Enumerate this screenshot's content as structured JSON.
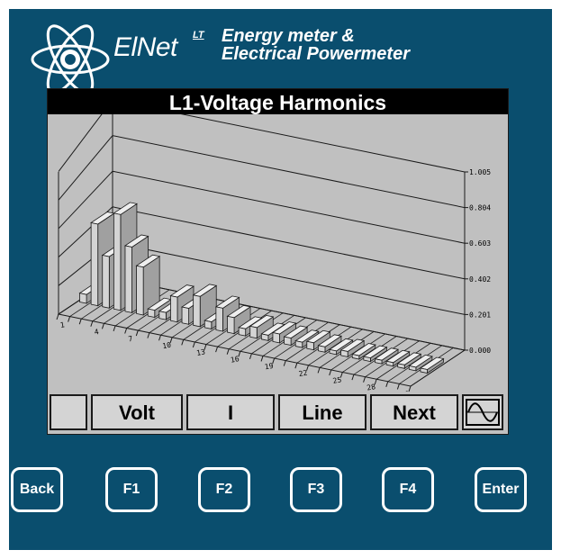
{
  "brand": {
    "name": "ElNet",
    "superscript": "LT",
    "tagline_line1": "Energy meter &",
    "tagline_line2": "Electrical Powermeter"
  },
  "screen": {
    "title": "L1-Voltage Harmonics"
  },
  "chart_data": {
    "type": "bar",
    "title": "L1-Voltage Harmonics",
    "style": "3d-bar",
    "x_tick_labels": [
      "1",
      "4",
      "7",
      "10",
      "13",
      "16",
      "19",
      "22",
      "25",
      "28",
      "31"
    ],
    "y_tick_labels": [
      "1.005",
      "0.804",
      "0.603",
      "0.402",
      "0.201",
      "0.000"
    ],
    "ylim": [
      0,
      1.005
    ],
    "categories": [
      "1",
      "2",
      "3",
      "4",
      "5",
      "6",
      "7",
      "8",
      "9",
      "10",
      "11",
      "12",
      "13",
      "14",
      "15",
      "16",
      "17",
      "18",
      "19",
      "20",
      "21",
      "22",
      "23",
      "24",
      "25",
      "26",
      "27",
      "28",
      "29",
      "30",
      "31"
    ],
    "values": [
      0.05,
      0.46,
      0.29,
      0.54,
      0.37,
      0.27,
      0.04,
      0.04,
      0.14,
      0.09,
      0.17,
      0.04,
      0.13,
      0.09,
      0.04,
      0.06,
      0.03,
      0.05,
      0.04,
      0.03,
      0.04,
      0.03,
      0.02,
      0.03,
      0.02,
      0.02,
      0.02,
      0.02,
      0.02,
      0.02,
      0.02
    ],
    "grid": true,
    "colors": {
      "bar_face": "#d4d4d4",
      "bar_side": "#a0a0a0",
      "bar_top": "#eeeeee",
      "grid": "#1a1a1a"
    }
  },
  "softkeys": {
    "blank": "",
    "volt": "Volt",
    "current": "I",
    "line": "Line",
    "next": "Next",
    "waveform_icon": "waveform-icon"
  },
  "hardkeys": {
    "back": "Back",
    "f1": "F1",
    "f2": "F2",
    "f3": "F3",
    "f4": "F4",
    "enter": "Enter"
  },
  "colors": {
    "device_bg": "#0a4e6e",
    "screen_bg": "#c0c0c0",
    "title_bar": "#000000"
  }
}
